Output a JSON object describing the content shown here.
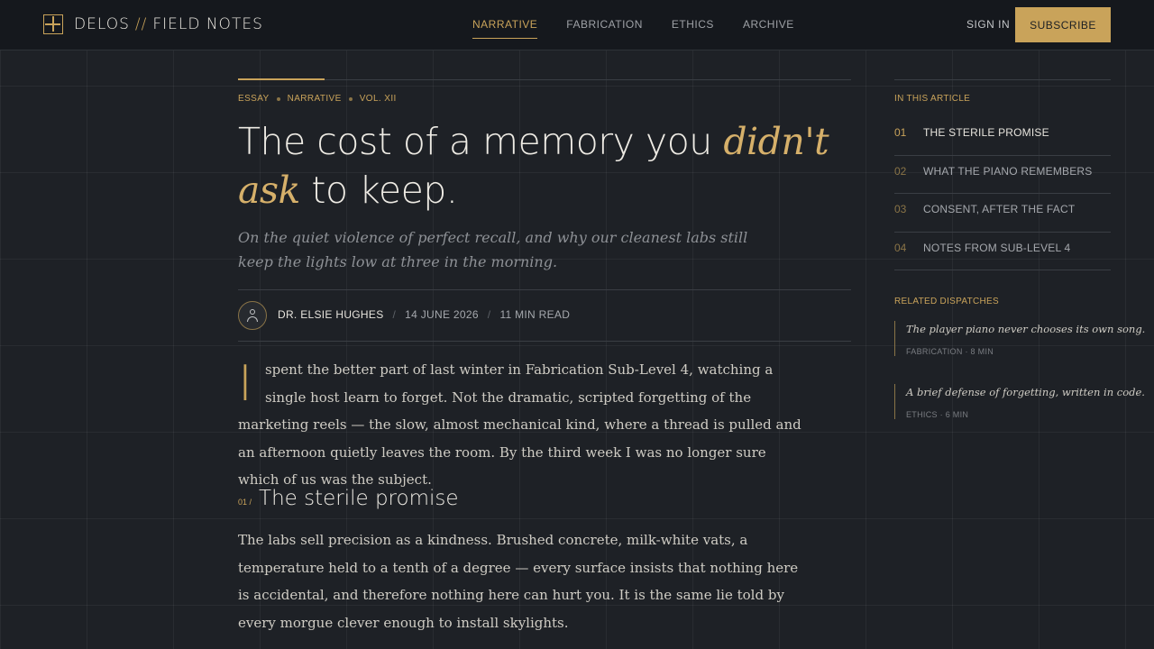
{
  "brand": {
    "name_left": "DELOS",
    "separator": "//",
    "name_right": "FIELD NOTES"
  },
  "nav": {
    "items": [
      {
        "label": "NARRATIVE",
        "active": true
      },
      {
        "label": "FABRICATION",
        "active": false
      },
      {
        "label": "ETHICS",
        "active": false
      },
      {
        "label": "ARCHIVE",
        "active": false
      }
    ],
    "sign_in": "SIGN IN",
    "subscribe": "SUBSCRIBE"
  },
  "article": {
    "kickers": [
      "ESSAY",
      "NARRATIVE",
      "VOL. XII"
    ],
    "headline": {
      "before": "The cost of a memory you ",
      "emphasis": "didn't ask",
      "after": " to keep."
    },
    "dek": "On the quiet violence of perfect recall, and why our cleanest labs still keep the lights low at three in the morning.",
    "author": "DR. ELSIE HUGHES",
    "date": "14 JUNE 2026",
    "read_time": "11 MIN READ",
    "byline_separator": "/",
    "paragraph1_dropcap": "I",
    "paragraph1": "spent the better part of last winter in Fabrication Sub-Level 4, watching a single host learn to forget. Not the dramatic, scripted forgetting of the marketing reels — the slow, almost mechanical kind, where a thread is pulled and an afternoon quietly leaves the room. By the third week I was no longer sure which of us was the subject.",
    "section1_number": "01 /",
    "section1_title": "The sterile promise",
    "paragraph2": "The labs sell precision as a kindness. Brushed concrete, milk-white vats, a temperature held to a tenth of a degree — every surface insists that nothing here is accidental, and therefore nothing here can hurt you. It is the same lie told by every morgue clever enough to install skylights."
  },
  "sidebar": {
    "toc_label": "IN THIS ARTICLE",
    "toc": [
      {
        "num": "01",
        "title": "THE STERILE PROMISE",
        "active": true
      },
      {
        "num": "02",
        "title": "WHAT THE PIANO REMEMBERS",
        "active": false
      },
      {
        "num": "03",
        "title": "CONSENT, AFTER THE FACT",
        "active": false
      },
      {
        "num": "04",
        "title": "NOTES FROM SUB-LEVEL 4",
        "active": false
      }
    ],
    "related_label": "RELATED DISPATCHES",
    "related": [
      {
        "title": "The player piano never chooses its own song.",
        "meta": "FABRICATION · 8 MIN"
      },
      {
        "title": "A brief defense of forgetting, written in code.",
        "meta": "ETHICS · 6 MIN"
      }
    ]
  },
  "colors": {
    "accent": "#c9a35a",
    "background": "#1e2126",
    "header": "#15181d"
  }
}
